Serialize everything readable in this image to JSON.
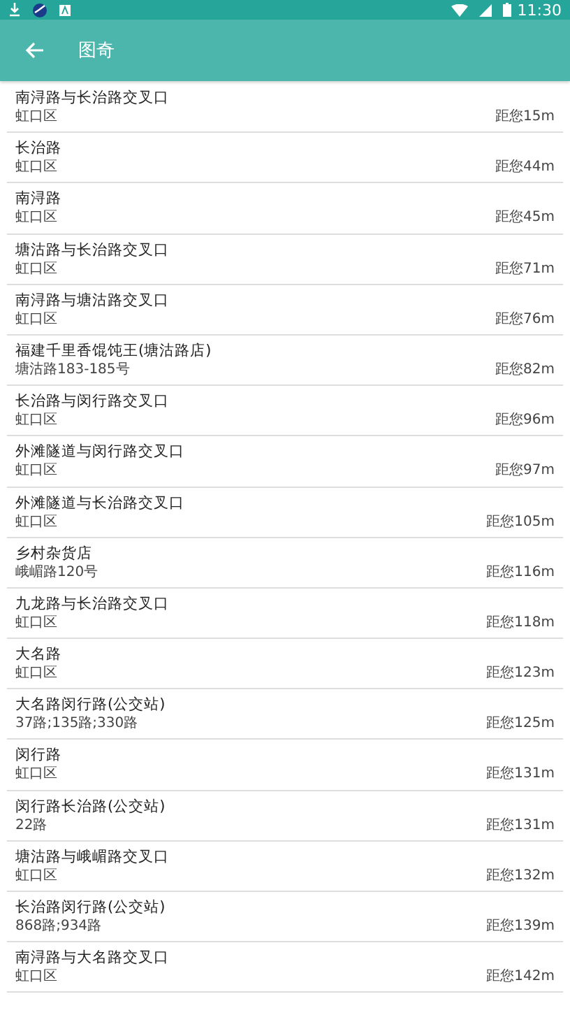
{
  "status_bar": {
    "time": "11:30"
  },
  "app_bar": {
    "title": "图奇"
  },
  "places": [
    {
      "name": "南浔路与长治路交叉口",
      "detail": "虹口区",
      "distance": "距您15m"
    },
    {
      "name": "长治路",
      "detail": "虹口区",
      "distance": "距您44m"
    },
    {
      "name": "南浔路",
      "detail": "虹口区",
      "distance": "距您45m"
    },
    {
      "name": "塘沽路与长治路交叉口",
      "detail": "虹口区",
      "distance": "距您71m"
    },
    {
      "name": "南浔路与塘沽路交叉口",
      "detail": "虹口区",
      "distance": "距您76m"
    },
    {
      "name": "福建千里香馄饨王(塘沽路店)",
      "detail": "塘沽路183-185号",
      "distance": "距您82m"
    },
    {
      "name": "长治路与闵行路交叉口",
      "detail": "虹口区",
      "distance": "距您96m"
    },
    {
      "name": "外滩隧道与闵行路交叉口",
      "detail": "虹口区",
      "distance": "距您97m"
    },
    {
      "name": "外滩隧道与长治路交叉口",
      "detail": "虹口区",
      "distance": "距您105m"
    },
    {
      "name": "乡村杂货店",
      "detail": "峨嵋路120号",
      "distance": "距您116m"
    },
    {
      "name": "九龙路与长治路交叉口",
      "detail": "虹口区",
      "distance": "距您118m"
    },
    {
      "name": "大名路",
      "detail": "虹口区",
      "distance": "距您123m"
    },
    {
      "name": "大名路闵行路(公交站)",
      "detail": "37路;135路;330路",
      "distance": "距您125m"
    },
    {
      "name": "闵行路",
      "detail": "虹口区",
      "distance": "距您131m"
    },
    {
      "name": "闵行路长治路(公交站)",
      "detail": "22路",
      "distance": "距您131m"
    },
    {
      "name": "塘沽路与峨嵋路交叉口",
      "detail": "虹口区",
      "distance": "距您132m"
    },
    {
      "name": "长治路闵行路(公交站)",
      "detail": "868路;934路",
      "distance": "距您139m"
    },
    {
      "name": "南浔路与大名路交叉口",
      "detail": "虹口区",
      "distance": "距您142m"
    }
  ]
}
